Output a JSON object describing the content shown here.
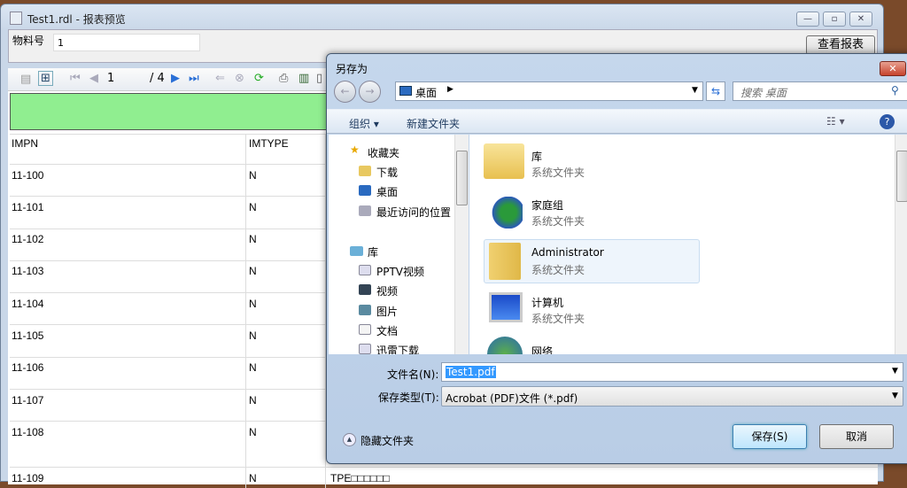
{
  "window": {
    "title": "Test1.rdl - 报表预览",
    "minimize": "—",
    "maximize": "▫",
    "close": "✕"
  },
  "params": {
    "label": "物料号",
    "value": "1",
    "view_button": "查看报表"
  },
  "toolbar": {
    "page_current": "1",
    "page_total": "/ 4"
  },
  "table": {
    "headers": [
      "IMPN",
      "IMTYPE"
    ],
    "rows": [
      [
        "11-100",
        "N"
      ],
      [
        "11-101",
        "N"
      ],
      [
        "11-102",
        "N"
      ],
      [
        "11-103",
        "N"
      ],
      [
        "11-104",
        "N"
      ],
      [
        "11-105",
        "N"
      ],
      [
        "11-106",
        "N"
      ],
      [
        "11-107",
        "N"
      ],
      [
        "11-108",
        "N"
      ],
      [
        "11-109",
        "N",
        "TPE□□□□□□"
      ]
    ]
  },
  "dialog": {
    "title": "另存为",
    "close": "✕",
    "location": "桌面",
    "search_placeholder": "搜索 桌面",
    "organize": "组织 ▾",
    "new_folder": "新建文件夹",
    "favorites": {
      "label": "收藏夹",
      "items": [
        "下载",
        "桌面",
        "最近访问的位置"
      ]
    },
    "libraries": {
      "label": "库",
      "items": [
        "PPTV视频",
        "视频",
        "图片",
        "文档",
        "迅雷下载"
      ]
    },
    "items": [
      {
        "name": "库",
        "type": "系统文件夹"
      },
      {
        "name": "家庭组",
        "type": "系统文件夹"
      },
      {
        "name": "Administrator",
        "type": "系统文件夹"
      },
      {
        "name": "计算机",
        "type": "系统文件夹"
      },
      {
        "name": "网络",
        "type": ""
      }
    ],
    "filename_label": "文件名(N):",
    "filename_value": "Test1.pdf",
    "filetype_label": "保存类型(T):",
    "filetype_value": "Acrobat (PDF)文件 (*.pdf)",
    "hide_folders": "隐藏文件夹",
    "save": "保存(S)",
    "cancel": "取消"
  }
}
